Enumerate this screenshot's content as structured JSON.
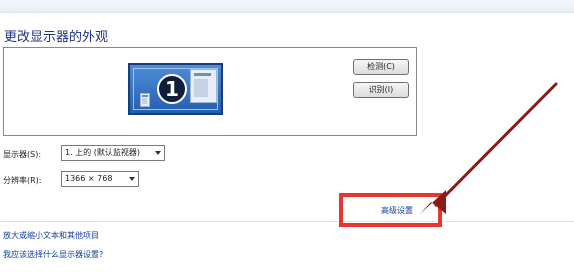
{
  "header": {
    "title": "更改显示器的外观"
  },
  "preview": {
    "monitor_number": "1",
    "detect_label": "检测(C)",
    "identify_label": "识别(I)"
  },
  "settings": {
    "display_label": "显示器(S):",
    "display_value": "1. 上的 (默认监视器)",
    "resolution_label": "分辨率(R):",
    "resolution_value": "1366 × 768"
  },
  "links": {
    "advanced": "高级设置",
    "enlarge_text": "放大或缩小文本和其他项目",
    "which_settings": "我应该选择什么显示器设置?"
  },
  "annotation": {
    "highlight_color": "#e8362f",
    "arrow_color": "#8b1a14"
  }
}
